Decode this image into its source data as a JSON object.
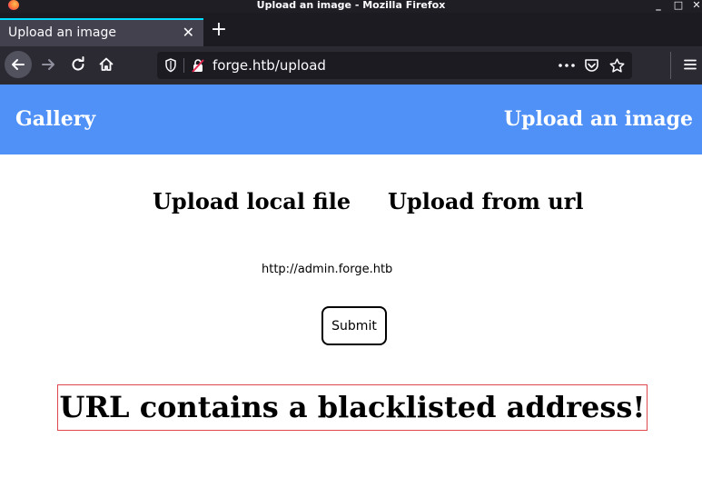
{
  "window": {
    "title": "Upload an image - Mozilla Firefox",
    "controls": {
      "minimize": "_",
      "maximize": "□",
      "close": "✕"
    }
  },
  "tab": {
    "title": "Upload an image",
    "close": "✕",
    "new_tab": "+"
  },
  "navbar": {
    "url": "forge.htb/upload",
    "icons": [
      "back-arrow-icon",
      "forward-arrow-icon",
      "reload-icon",
      "home-icon",
      "shield-icon",
      "insecure-lock-icon",
      "more-actions-icon",
      "pocket-icon",
      "bookmark-star-icon",
      "hamburger-menu-icon"
    ]
  },
  "site_header": {
    "gallery": "Gallery",
    "upload": "Upload an image"
  },
  "upload_options": {
    "local": "Upload local file",
    "url": "Upload from url"
  },
  "form": {
    "url_value": "http://admin.forge.htb",
    "submit_label": "Submit"
  },
  "error": {
    "message": "URL contains a blacklisted address!"
  },
  "colors": {
    "header_blue": "#5091f8",
    "error_border": "#e0474c",
    "accent_tab": "#00ddff"
  }
}
